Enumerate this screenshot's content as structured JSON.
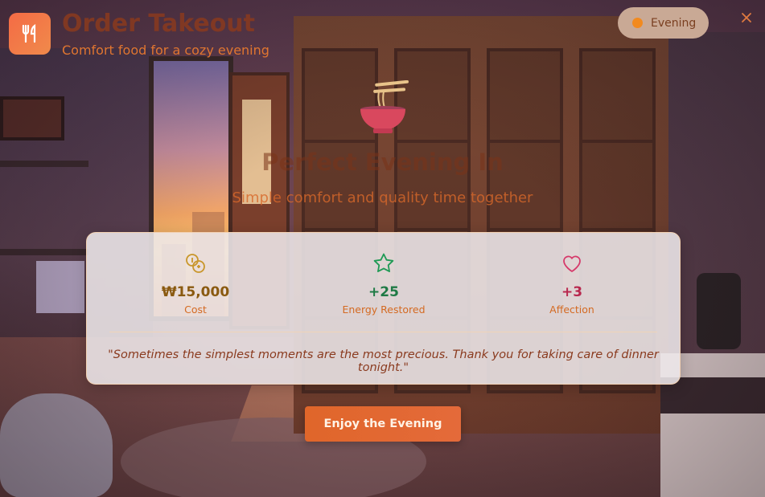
{
  "header": {
    "app_icon": "fork-knife-icon",
    "title": "Order Takeout",
    "subtitle": "Comfort food for a cozy evening",
    "time_badge": "Evening",
    "close_icon": "close-icon"
  },
  "hero": {
    "icon": "noodle-bowl-icon",
    "title": "Perfect Evening In",
    "subtitle": "Simple comfort and quality time together"
  },
  "stats": [
    {
      "icon": "coins-icon",
      "value": "₩15,000",
      "label": "Cost",
      "color": "#8a5a10"
    },
    {
      "icon": "star-icon",
      "value": "+25",
      "label": "Energy Restored",
      "color": "#1f7a45"
    },
    {
      "icon": "heart-icon",
      "value": "+3",
      "label": "Affection",
      "color": "#b8284e"
    }
  ],
  "quote": "\"Sometimes the simplest moments are the most precious. Thank you for taking care of dinner tonight.\"",
  "cta_label": "Enjoy the Evening",
  "colors": {
    "accent": "#e0662a",
    "badge_dot": "#f28a1f"
  }
}
